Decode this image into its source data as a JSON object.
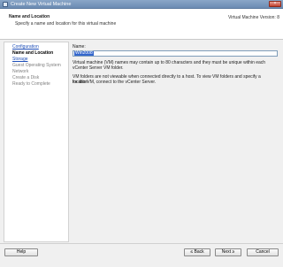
{
  "window": {
    "title": "Create New Virtual Machine",
    "close_glyph": "×"
  },
  "header": {
    "title": "Name and Location",
    "subtitle": "Specify a name and location for this virtual machine",
    "version": "Virtual Machine Version: 8"
  },
  "nav": {
    "items": [
      {
        "label": "Configuration",
        "state": "link"
      },
      {
        "label": "Name and Location",
        "state": "current"
      },
      {
        "label": "Storage",
        "state": "link"
      },
      {
        "label": "Guest Operating System",
        "state": "inactive"
      },
      {
        "label": "Network",
        "state": "inactive"
      },
      {
        "label": "Create a Disk",
        "state": "inactive"
      },
      {
        "label": "Ready to Complete",
        "state": "inactive"
      }
    ]
  },
  "form": {
    "name_label": "Name:",
    "name_value": "Win2008",
    "info_line1": "Virtual machine (VM) names may contain up to 80 characters and they must be unique within each",
    "info_line2": "vCenter Server VM folder.",
    "info_line3": "VM folders are not viewable when connected directly to a host. To view VM folders and specify a location",
    "info_line4": "for this VM, connect to the vCenter Server."
  },
  "footer": {
    "help": "Help",
    "back": "≤ Back",
    "next": "Next ≥",
    "cancel": "Cancel"
  }
}
